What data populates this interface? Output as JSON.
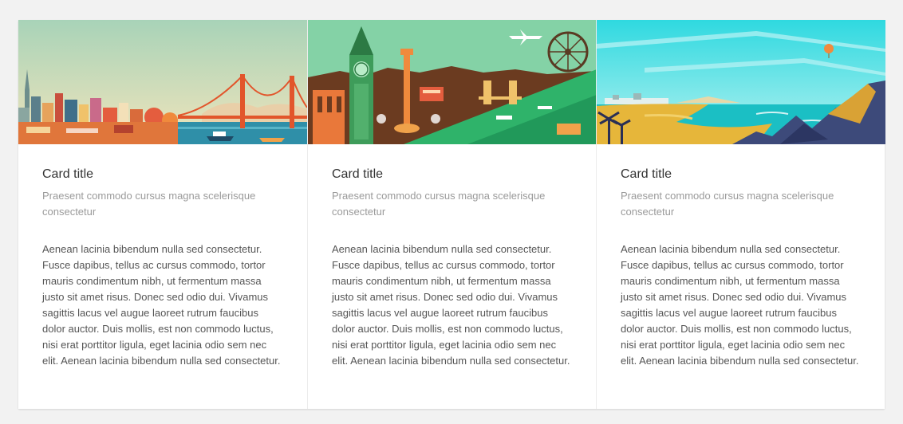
{
  "cards": [
    {
      "image": "san-francisco-illustration",
      "title": "Card title",
      "subtitle": "Praesent commodo cursus magna scelerisque consectetur",
      "text": "Aenean lacinia bibendum nulla sed consectetur. Fusce dapibus, tellus ac cursus commodo, tortor mauris condimentum nibh, ut fermentum massa justo sit amet risus. Donec sed odio dui. Vivamus sagittis lacus vel augue laoreet rutrum faucibus dolor auctor. Duis mollis, est non commodo luctus, nisi erat porttitor ligula, eget lacinia odio sem nec elit. Aenean lacinia bibendum nulla sed consectetur."
    },
    {
      "image": "london-illustration",
      "title": "Card title",
      "subtitle": "Praesent commodo cursus magna scelerisque consectetur",
      "text": "Aenean lacinia bibendum nulla sed consectetur. Fusce dapibus, tellus ac cursus commodo, tortor mauris condimentum nibh, ut fermentum massa justo sit amet risus. Donec sed odio dui. Vivamus sagittis lacus vel augue laoreet rutrum faucibus dolor auctor. Duis mollis, est non commodo luctus, nisi erat porttitor ligula, eget lacinia odio sem nec elit. Aenean lacinia bibendum nulla sed consectetur."
    },
    {
      "image": "beach-illustration",
      "title": "Card title",
      "subtitle": "Praesent commodo cursus magna scelerisque consectetur",
      "text": "Aenean lacinia bibendum nulla sed consectetur. Fusce dapibus, tellus ac cursus commodo, tortor mauris condimentum nibh, ut fermentum massa justo sit amet risus. Donec sed odio dui. Vivamus sagittis lacus vel augue laoreet rutrum faucibus dolor auctor. Duis mollis, est non commodo luctus, nisi erat porttitor ligula, eget lacinia odio sem nec elit. Aenean lacinia bibendum nulla sed consectetur."
    }
  ],
  "colors": {
    "page_background": "#f2f2f2",
    "card_background": "#ffffff",
    "title": "#333333",
    "subtitle": "#9a9a9a",
    "body_text": "#555555"
  }
}
